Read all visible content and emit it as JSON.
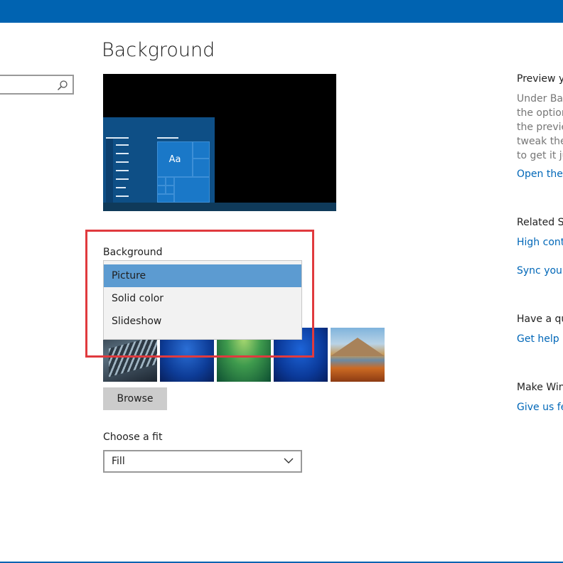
{
  "page": {
    "title": "Background"
  },
  "search": {
    "placeholder": "",
    "icon": "search-icon"
  },
  "preview": {
    "tile_text": "Aa"
  },
  "background": {
    "label": "Background",
    "options": [
      "Picture",
      "Solid color",
      "Slideshow"
    ],
    "selected": "Picture"
  },
  "browse_label": "Browse",
  "fit": {
    "label": "Choose a fit",
    "value": "Fill"
  },
  "right_panel": {
    "preview_heading": "Preview yo",
    "preview_lines": [
      "Under Bac",
      "the option",
      "the previe",
      "tweak the",
      "to get it ju"
    ],
    "open_link": "Open ther",
    "related_heading": "Related Se",
    "high_contrast_link": "High cont",
    "sync_link": "Sync your",
    "question_heading": "Have a qu",
    "get_help_link": "Get help",
    "make_heading": "Make Win",
    "feedback_link": "Give us fe"
  },
  "colors": {
    "accent": "#0063b1",
    "link": "#0067b8",
    "selection": "#5c9bd1",
    "highlight_box": "#e03a3e"
  }
}
